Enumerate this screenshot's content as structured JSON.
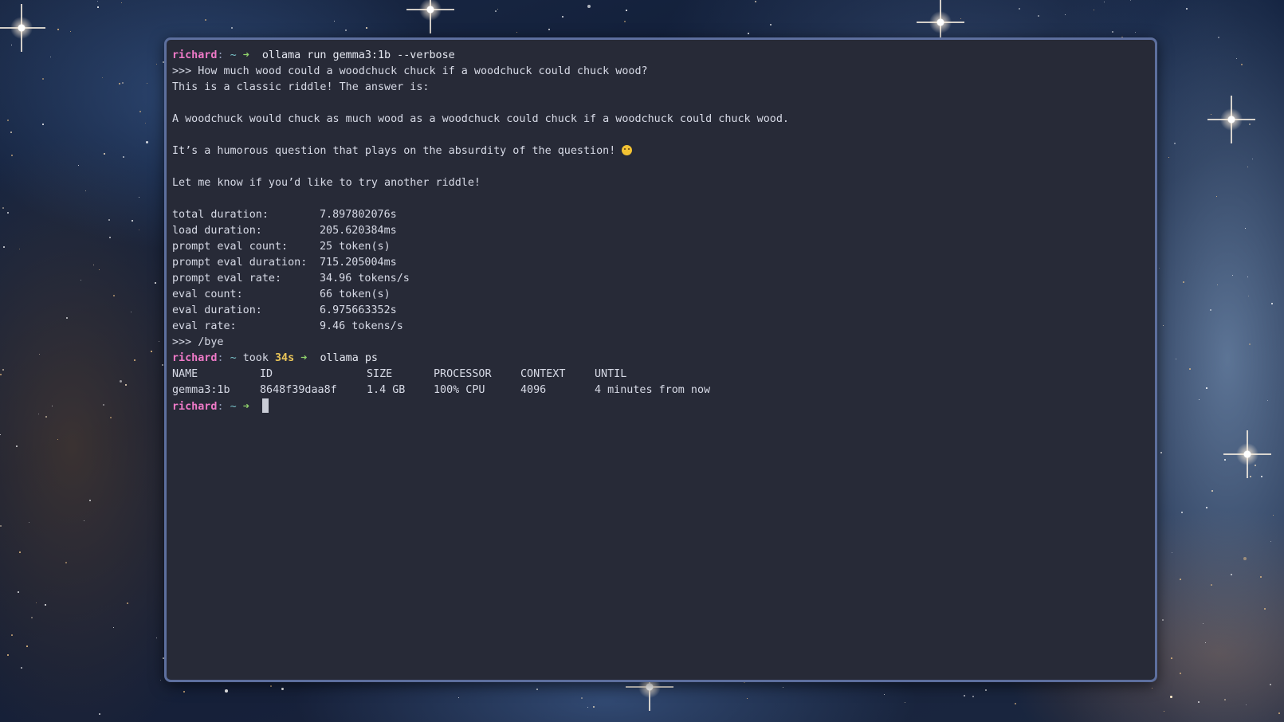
{
  "prompt": {
    "user": "richard",
    "separator": ":",
    "dir": "~",
    "arrow": "➜",
    "took_label": "took",
    "took_value": "34s"
  },
  "commands": {
    "first": "ollama run gemma3:1b --verbose",
    "second": "ollama ps"
  },
  "session": {
    "question": ">>> How much wood could a woodchuck chuck if a woodchuck could chuck wood?",
    "answer_intro": "This is a classic riddle! The answer is:",
    "answer_main": "A woodchuck would chuck as much wood as a woodchuck could chuck if a woodchuck could chuck wood.",
    "answer_humor": "It’s a humorous question that plays on the absurdity of the question!",
    "emoji_name": "smiling-face-emoji",
    "answer_outro": "Let me know if you’d like to try another riddle!",
    "bye": ">>> /bye"
  },
  "stats": [
    {
      "label": "total duration:",
      "value": "7.897802076s"
    },
    {
      "label": "load duration:",
      "value": "205.620384ms"
    },
    {
      "label": "prompt eval count:",
      "value": "25 token(s)"
    },
    {
      "label": "prompt eval duration:",
      "value": "715.205004ms"
    },
    {
      "label": "prompt eval rate:",
      "value": "34.96 tokens/s"
    },
    {
      "label": "eval count:",
      "value": "66 token(s)"
    },
    {
      "label": "eval duration:",
      "value": "6.975663352s"
    },
    {
      "label": "eval rate:",
      "value": "9.46 tokens/s"
    }
  ],
  "ps_table": {
    "headers": [
      "NAME",
      "ID",
      "SIZE",
      "PROCESSOR",
      "CONTEXT",
      "UNTIL"
    ],
    "rows": [
      [
        "gemma3:1b",
        "8648f39daa8f",
        "1.4 GB",
        "100% CPU",
        "4096",
        "4 minutes from now"
      ]
    ]
  },
  "colors": {
    "terminal_bg": "#272a37",
    "terminal_border": "#5d6f9e",
    "user": "#f07ac8",
    "arrow": "#8fd16b",
    "duration": "#eac558",
    "text": "#d7dae6"
  }
}
